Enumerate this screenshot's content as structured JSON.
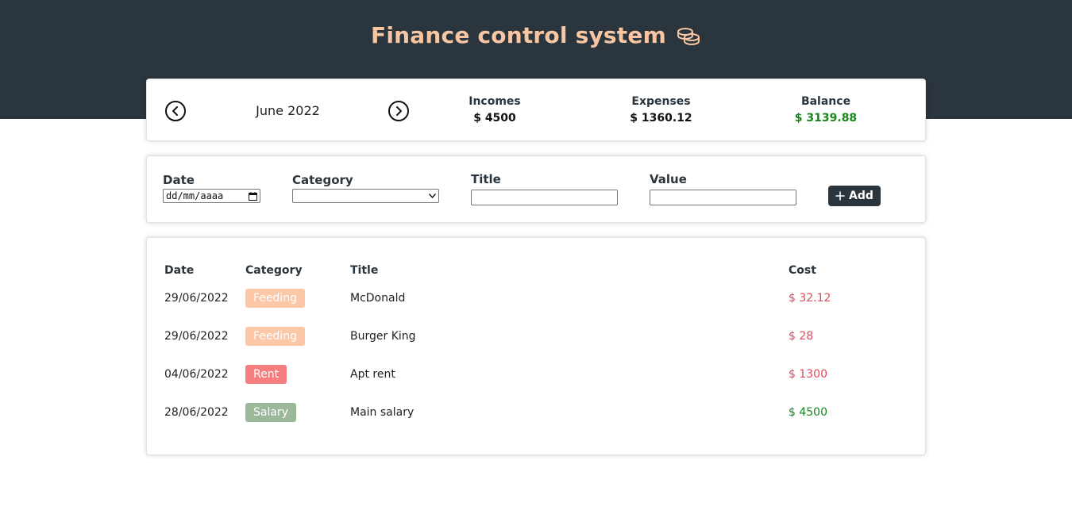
{
  "header": {
    "title": "Finance control system"
  },
  "summary": {
    "month": "June 2022",
    "incomes": {
      "label": "Incomes",
      "value": "$ 4500"
    },
    "expenses": {
      "label": "Expenses",
      "value": "$ 1360.12"
    },
    "balance": {
      "label": "Balance",
      "value": "$ 3139.88",
      "color": "#17861c"
    }
  },
  "form": {
    "date": {
      "label": "Date",
      "placeholder": "dd/mm/aaaa"
    },
    "category": {
      "label": "Category",
      "value": ""
    },
    "title": {
      "label": "Title",
      "value": ""
    },
    "value": {
      "label": "Value",
      "value": ""
    },
    "add_label": "Add"
  },
  "table": {
    "headers": {
      "date": "Date",
      "category": "Category",
      "title": "Title",
      "cost": "Cost"
    },
    "rows": [
      {
        "date": "29/06/2022",
        "category": "Feeding",
        "category_color": "#fbc7a6",
        "title": "McDonald",
        "cost": "$ 32.12",
        "cost_color": "#e2475b"
      },
      {
        "date": "29/06/2022",
        "category": "Feeding",
        "category_color": "#fbc7a6",
        "title": "Burger King",
        "cost": "$ 28",
        "cost_color": "#e2475b"
      },
      {
        "date": "04/06/2022",
        "category": "Rent",
        "category_color": "#f57f7f",
        "title": "Apt rent",
        "cost": "$ 1300",
        "cost_color": "#e2475b"
      },
      {
        "date": "28/06/2022",
        "category": "Salary",
        "category_color": "#9bb89b",
        "title": "Main salary",
        "cost": "$ 4500",
        "cost_color": "#17861c"
      }
    ]
  },
  "colors": {
    "header_bg": "#2b353d",
    "title_accent": "#f8c6a3",
    "expense": "#e2475b",
    "income": "#17861c"
  }
}
